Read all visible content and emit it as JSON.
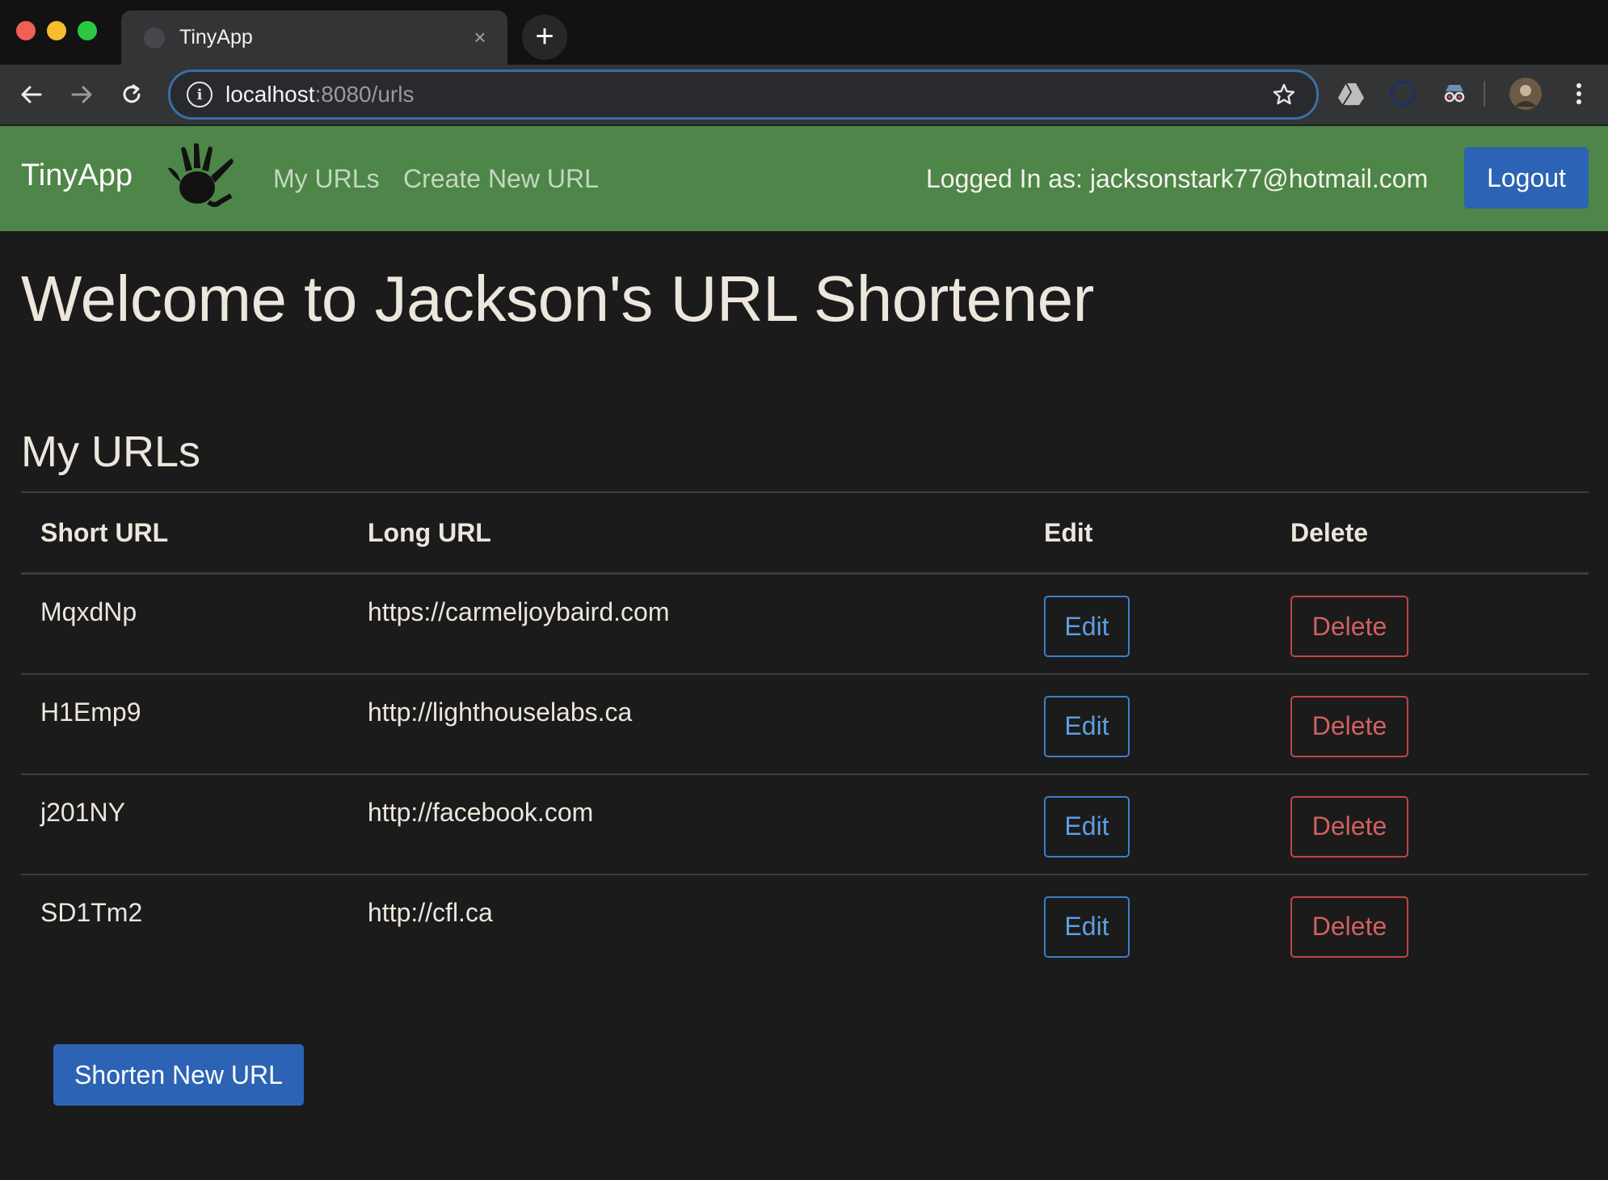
{
  "browser": {
    "tab_title": "TinyApp",
    "new_tab_label": "+",
    "close_label": "×",
    "url_host": "localhost",
    "url_rest": ":8080/urls",
    "info_label": "i"
  },
  "navbar": {
    "brand": "TinyApp",
    "links": [
      "My URLs",
      "Create New URL"
    ],
    "logged_in": "Logged In as: jacksonstark77@hotmail.com",
    "logout_label": "Logout",
    "color": "#4e8548"
  },
  "main": {
    "heading": "Welcome to Jackson's URL Shortener",
    "subheading": "My URLs",
    "columns": [
      "Short URL",
      "Long URL",
      "Edit",
      "Delete"
    ],
    "rows": [
      {
        "short": "MqxdNp",
        "long": "https://carmeljoybaird.com",
        "edit": "Edit",
        "delete": "Delete"
      },
      {
        "short": "H1Emp9",
        "long": "http://lighthouselabs.ca",
        "edit": "Edit",
        "delete": "Delete"
      },
      {
        "short": "j201NY",
        "long": "http://facebook.com",
        "edit": "Edit",
        "delete": "Delete"
      },
      {
        "short": "SD1Tm2",
        "long": "http://cfl.ca",
        "edit": "Edit",
        "delete": "Delete"
      }
    ],
    "shorten_label": "Shorten New URL"
  },
  "colors": {
    "primary": "#2c63b4",
    "edit_outline": "#3a7fc8",
    "delete_outline": "#c04545",
    "background": "#1b1b1b"
  }
}
